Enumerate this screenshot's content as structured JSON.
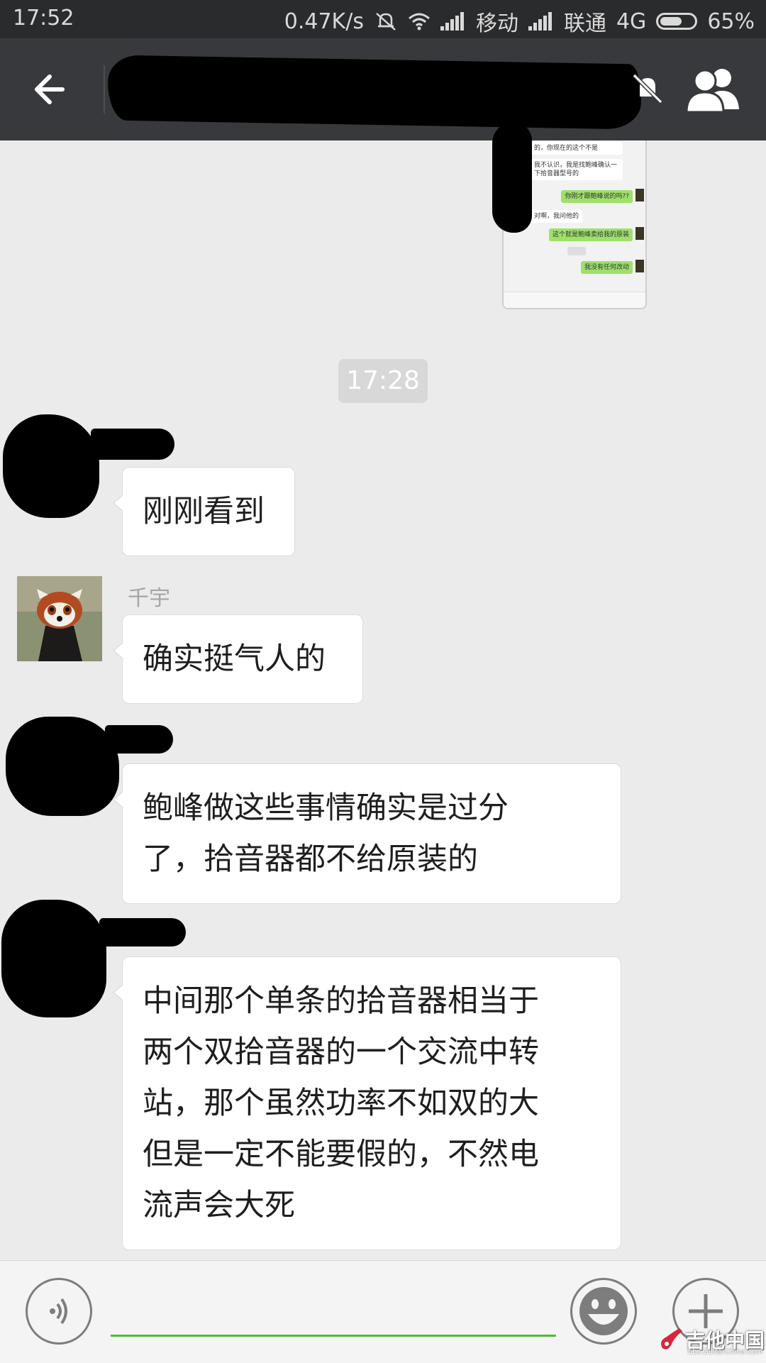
{
  "status_bar": {
    "time": "17:52",
    "net_speed": "0.47K/s",
    "carrier1": "移动",
    "carrier2": "联通",
    "network": "4G",
    "battery": "65%",
    "battery_level": 0.65
  },
  "header": {
    "back_icon": "arrow-left-icon",
    "mute_icon": "bell-off-icon",
    "members_icon": "group-people-icon"
  },
  "forwarded_image": {
    "lines": [
      "的，你现在的这个不是",
      "我不认识，我是找鲍峰确认一下拾音器型号的",
      "你刚才跟鲍峰说的吗??",
      "对啊，我问他的",
      "这个就是鲍峰卖给我的原装",
      "我没有任何改动"
    ]
  },
  "time_divider": "17:28",
  "messages": [
    {
      "sender": "",
      "text": "刚刚看到"
    },
    {
      "sender": "千宇",
      "text": "确实挺气人的"
    },
    {
      "sender": "",
      "text": "鲍峰做这些事情确实是过分\n了，拾音器都不给原装的"
    },
    {
      "sender": "",
      "text": "中间那个单条的拾音器相当于\n两个双拾音器的一个交流中转\n站，那个虽然功率不如双的大\n但是一定不能要假的，不然电\n流声会大死"
    }
  ],
  "input_bar": {
    "voice_icon": "voice-icon",
    "emoji_icon": "emoji-icon",
    "plus_icon": "plus-icon",
    "input_value": ""
  },
  "watermark": {
    "text": "吉他中国",
    "sub": "bbs.GuitarChina.com"
  },
  "colors": {
    "accent_green": "#4dbd34",
    "header_bg": "#38393d",
    "chat_bg": "#ebebeb"
  }
}
